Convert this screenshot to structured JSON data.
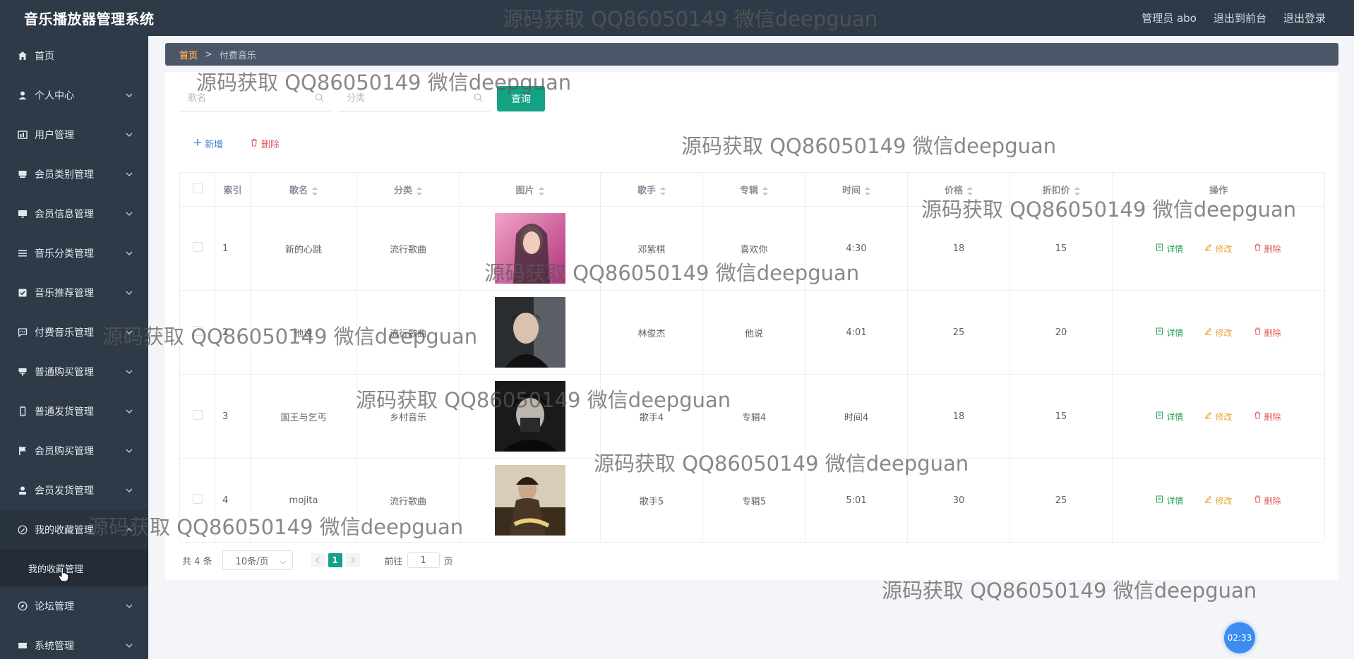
{
  "header": {
    "title": "音乐播放器管理系统",
    "admin": "管理员 abo",
    "to_front": "退出到前台",
    "logout": "退出登录"
  },
  "sidebar": {
    "items": [
      {
        "label": "首页",
        "icon": "home-icon",
        "has_arrow": false
      },
      {
        "label": "个人中心",
        "icon": "user-icon",
        "has_arrow": true
      },
      {
        "label": "用户管理",
        "icon": "chart-icon",
        "has_arrow": true
      },
      {
        "label": "会员类别管理",
        "icon": "device-icon",
        "has_arrow": true
      },
      {
        "label": "会员信息管理",
        "icon": "monitor-icon",
        "has_arrow": true
      },
      {
        "label": "音乐分类管理",
        "icon": "list-icon",
        "has_arrow": true
      },
      {
        "label": "音乐推荐管理",
        "icon": "check-icon",
        "has_arrow": true
      },
      {
        "label": "付费音乐管理",
        "icon": "chat-icon",
        "has_arrow": true
      },
      {
        "label": "普通购买管理",
        "icon": "cup-icon",
        "has_arrow": true
      },
      {
        "label": "普通发货管理",
        "icon": "phone-icon",
        "has_arrow": true
      },
      {
        "label": "会员购买管理",
        "icon": "flag-icon",
        "has_arrow": true
      },
      {
        "label": "会员发货管理",
        "icon": "person-icon",
        "has_arrow": true
      },
      {
        "label": "我的收藏管理",
        "icon": "pen-icon",
        "has_arrow": true,
        "open": true
      },
      {
        "label": "论坛管理",
        "icon": "compass-icon",
        "has_arrow": true
      },
      {
        "label": "系统管理",
        "icon": "ticket-icon",
        "has_arrow": true
      }
    ],
    "sub_item": "我的收藏管理"
  },
  "breadcrumb": {
    "home": "首页",
    "sep": ">",
    "current": "付费音乐"
  },
  "search": {
    "song_placeholder": "歌名",
    "category_placeholder": "分类",
    "query_label": "查询"
  },
  "actions": {
    "add": "新增",
    "delete": "删除"
  },
  "table": {
    "headers": [
      "索引",
      "歌名",
      "分类",
      "图片",
      "歌手",
      "专辑",
      "时间",
      "价格",
      "折扣价",
      "操作"
    ],
    "rows": [
      {
        "index": "1",
        "name": "新的心跳",
        "category": "流行歌曲",
        "singer": "邓紫棋",
        "album": "喜欢你",
        "time": "4:30",
        "price": "18",
        "discount": "15"
      },
      {
        "index": "2",
        "name": "他说",
        "category": "流行歌曲",
        "singer": "林俊杰",
        "album": "他说",
        "time": "4:01",
        "price": "25",
        "discount": "20"
      },
      {
        "index": "3",
        "name": "国王与乞丐",
        "category": "乡村音乐",
        "singer": "歌手4",
        "album": "专辑4",
        "time": "时间4",
        "price": "18",
        "discount": "15"
      },
      {
        "index": "4",
        "name": "mojita",
        "category": "流行歌曲",
        "singer": "歌手5",
        "album": "专辑5",
        "time": "5:01",
        "price": "30",
        "discount": "25"
      }
    ],
    "op_detail": "详情",
    "op_edit": "修改",
    "op_delete": "删除"
  },
  "pagination": {
    "total": "共 4 条",
    "page_size": "10条/页",
    "current": "1",
    "goto_prefix": "前往",
    "goto_value": "1",
    "goto_suffix": "页"
  },
  "watermark": "源码获取 QQ86050149 微信deepguan",
  "timer": "02:33",
  "colors": {
    "sidebar": "#2f3a48",
    "accent": "#15a284",
    "breadcrumb": "#4b5668"
  }
}
